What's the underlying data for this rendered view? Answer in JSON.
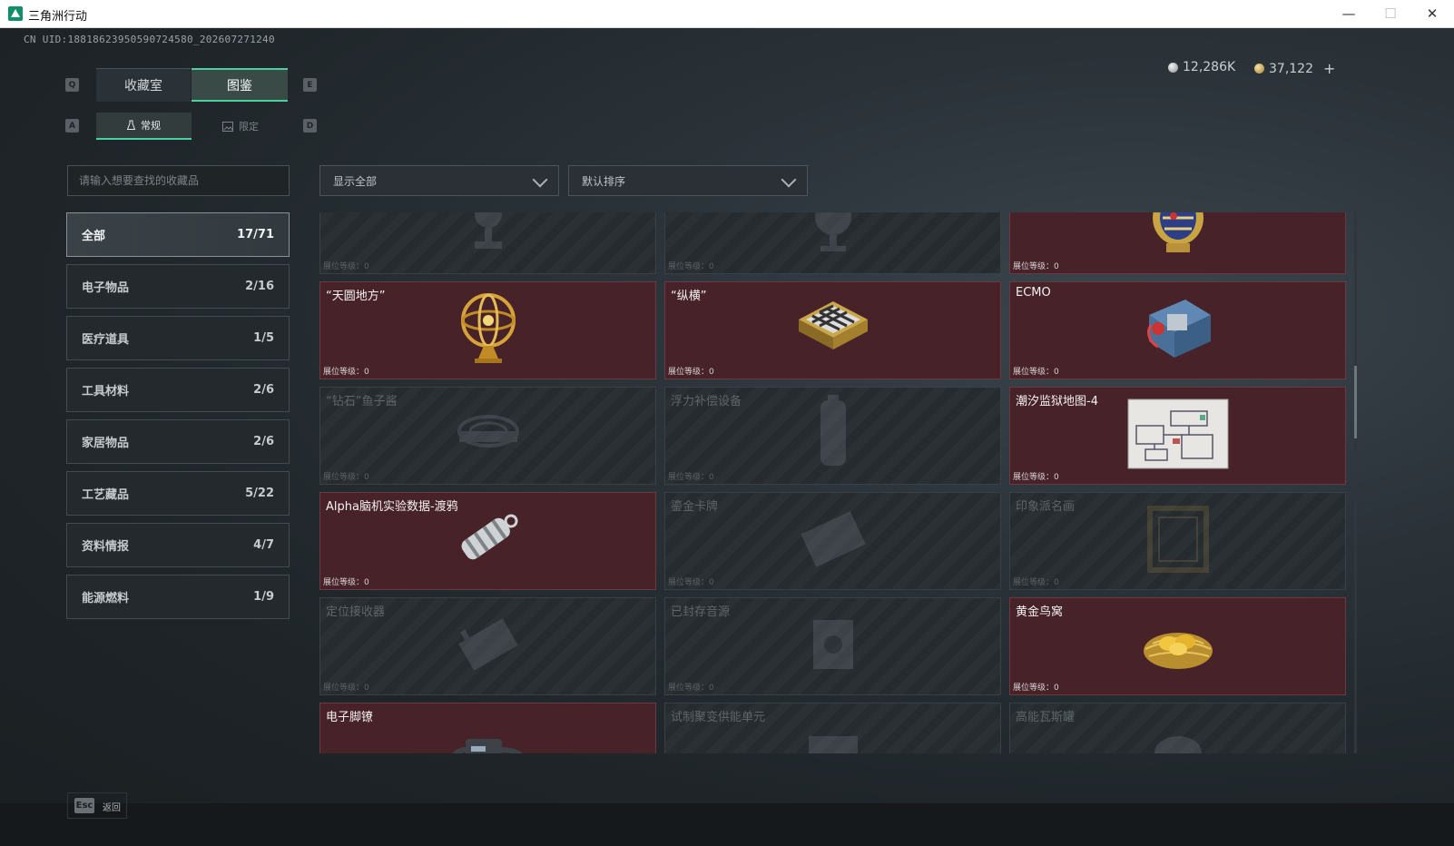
{
  "window": {
    "title": "三角洲行动",
    "minimize": "—",
    "maximize": "☐",
    "close": "✕"
  },
  "uid": "CN UID:18818623950590724580_202607271240",
  "currency": {
    "silver": "12,286K",
    "gold": "37,122",
    "plus": "+"
  },
  "tabs": {
    "main": [
      {
        "label": "收藏室",
        "key": "Q"
      },
      {
        "label": "图鉴",
        "key": "E"
      }
    ],
    "sub": [
      {
        "label": "常规",
        "key": "A"
      },
      {
        "label": "限定",
        "key": "D"
      }
    ]
  },
  "search": {
    "placeholder": "请输入想要查找的收藏品"
  },
  "filters": {
    "show": "显示全部",
    "sort": "默认排序"
  },
  "categories": [
    {
      "label": "全部",
      "count": "17/71"
    },
    {
      "label": "电子物品",
      "count": "2/16"
    },
    {
      "label": "医疗道具",
      "count": "1/5"
    },
    {
      "label": "工具材料",
      "count": "2/6"
    },
    {
      "label": "家居物品",
      "count": "2/6"
    },
    {
      "label": "工艺藏品",
      "count": "5/22"
    },
    {
      "label": "资料情报",
      "count": "4/7"
    },
    {
      "label": "能源燃料",
      "count": "1/9"
    }
  ],
  "level_label": "展位等级：0",
  "items": [
    {
      "name": "",
      "owned": false,
      "icon": "trophy-icon"
    },
    {
      "name": "",
      "owned": false,
      "icon": "globe-icon"
    },
    {
      "name": "",
      "owned": true,
      "icon": "jeweled-egg-icon"
    },
    {
      "name": "“天圆地方”",
      "owned": true,
      "icon": "armillary-sphere-icon"
    },
    {
      "name": "“纵横”",
      "owned": true,
      "icon": "chessboard-icon"
    },
    {
      "name": "ECMO",
      "owned": true,
      "icon": "ecmo-machine-icon"
    },
    {
      "name": "“钻石”鱼子酱",
      "owned": false,
      "icon": "caviar-tin-icon"
    },
    {
      "name": "浮力补偿设备",
      "owned": false,
      "icon": "buoyancy-device-icon"
    },
    {
      "name": "潮汐监狱地图-4",
      "owned": true,
      "icon": "map-sheet-icon"
    },
    {
      "name": "Alpha脑机实验数据-渡鸦",
      "owned": true,
      "icon": "data-canister-icon"
    },
    {
      "name": "鎏金卡牌",
      "owned": false,
      "icon": "gilded-card-icon"
    },
    {
      "name": "印象派名画",
      "owned": false,
      "icon": "painting-frame-icon"
    },
    {
      "name": "定位接收器",
      "owned": false,
      "icon": "locator-receiver-icon"
    },
    {
      "name": "已封存音源",
      "owned": false,
      "icon": "sealed-audio-icon"
    },
    {
      "name": "黄金鸟窝",
      "owned": true,
      "icon": "golden-nest-icon"
    },
    {
      "name": "电子脚镣",
      "owned": true,
      "icon": "ankle-monitor-icon"
    },
    {
      "name": "试制聚变供能单元",
      "owned": false,
      "icon": "fusion-cell-icon"
    },
    {
      "name": "高能瓦斯罐",
      "owned": false,
      "icon": "gas-canister-icon"
    }
  ],
  "footer": {
    "esc_key": "Esc",
    "esc_label": "返回"
  }
}
